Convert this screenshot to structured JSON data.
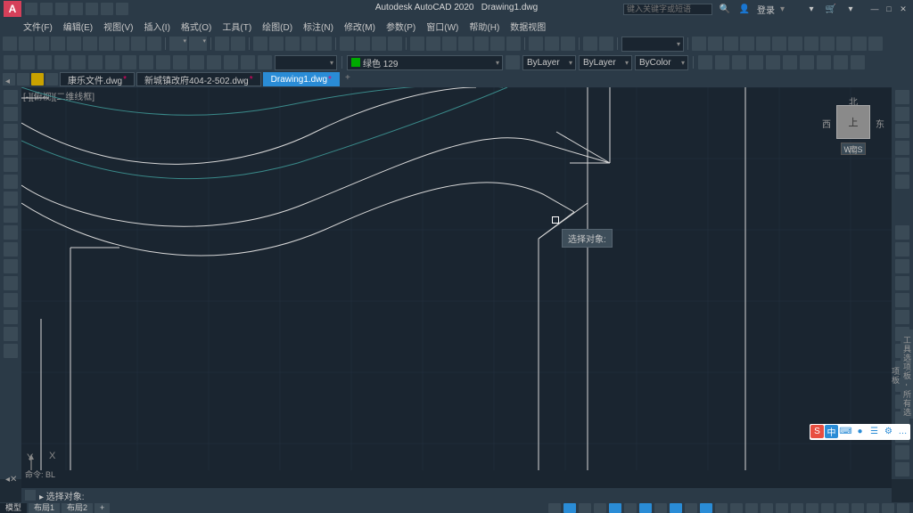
{
  "title": {
    "app": "Autodesk AutoCAD 2020",
    "file": "Drawing1.dwg"
  },
  "search": {
    "placeholder": "键入关键字或短语"
  },
  "login": {
    "label": "登录"
  },
  "menu": [
    "文件(F)",
    "编辑(E)",
    "视图(V)",
    "插入(I)",
    "格式(O)",
    "工具(T)",
    "绘图(D)",
    "标注(N)",
    "修改(M)",
    "参数(P)",
    "窗口(W)",
    "帮助(H)",
    "数据视图"
  ],
  "property_bar": {
    "layer": "绿色 129",
    "linetype": "ByLayer",
    "lineweight": "ByLayer",
    "plotstyle": "ByColor"
  },
  "tabs": [
    {
      "label": "康乐文件.dwg",
      "active": false,
      "dirty": true
    },
    {
      "label": "新城镇改府404-2-502.dwg",
      "active": false,
      "dirty": true
    },
    {
      "label": "Drawing1.dwg",
      "active": true,
      "dirty": true
    }
  ],
  "viewport_label": "[-][俯视][二维线框]",
  "viewcube": {
    "top": "北",
    "left": "西",
    "right": "东",
    "bottom": "南",
    "face": "上",
    "wcs": "WCS"
  },
  "tooltip": "选择对象:",
  "command": {
    "history_line": "命令: BL",
    "prompt": "▸ 选择对象:"
  },
  "model_tabs": [
    "模型",
    "布局1",
    "布局2"
  ],
  "palette_label": "工具选项板 - 所有选项板",
  "ucs": {
    "y": "Y",
    "x": "X"
  },
  "window_controls": {
    "min": "—",
    "max": "□",
    "close": "✕"
  },
  "ime": {
    "logo": "S",
    "items": [
      "中",
      "⌨",
      "●",
      "☰",
      "⚙",
      "…"
    ]
  }
}
